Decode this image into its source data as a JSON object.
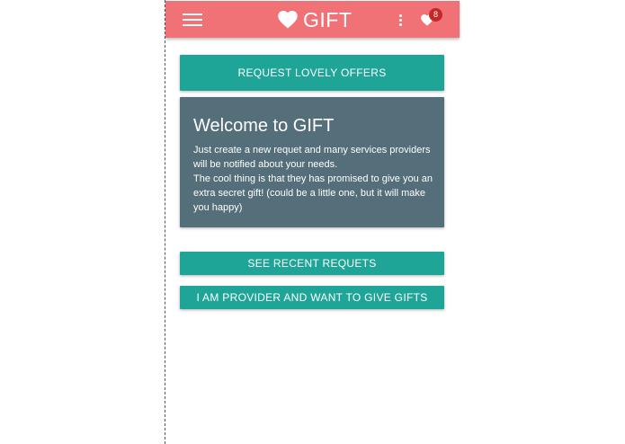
{
  "app_bar": {
    "title": "GIFT",
    "menu_icon": "hamburger-menu-icon",
    "brand_icon": "heart-icon",
    "more_icon": "more-vertical-icon",
    "favorites_icon": "heart-icon",
    "favorites_count": "8",
    "background_color": "#f07277"
  },
  "main": {
    "request_offers_label": "REQUEST LOVELY OFFERS",
    "welcome": {
      "title": "Welcome to GIFT",
      "lines": [
        "Just create a new requet and many services providers",
        "will be notified about your needs.",
        "The cool thing is that they has promised to give you an",
        "extra secret gift! (could be a little one, but it will make",
        "you happy)"
      ],
      "background_color": "#546e7a"
    },
    "recent_requests_label": "SEE RECENT REQUETS",
    "provider_label": "I AM PROVIDER AND WANT TO GIVE GIFTS",
    "button_color": "#1ea597"
  }
}
